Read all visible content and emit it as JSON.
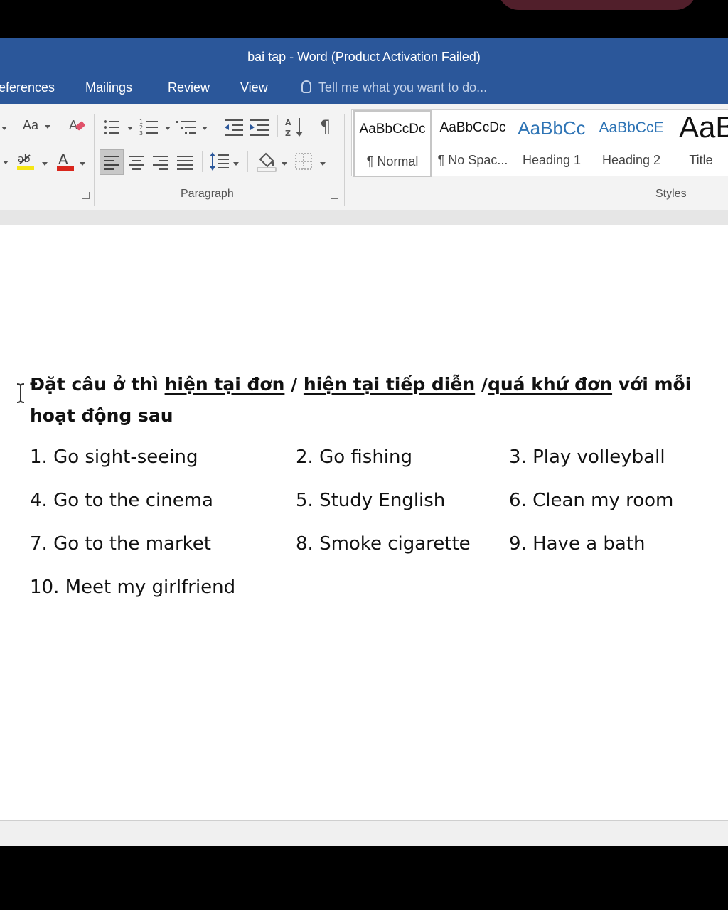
{
  "window": {
    "title": "bai tap - Word (Product Activation Failed)"
  },
  "tabs": [
    {
      "label": "eferences"
    },
    {
      "label": "Mailings"
    },
    {
      "label": "Review"
    },
    {
      "label": "View"
    }
  ],
  "tell_me": {
    "placeholder": "Tell me what you want to do..."
  },
  "ribbon": {
    "change_case_label": "Aa",
    "paragraph_label": "Paragraph",
    "styles_label": "Styles",
    "styles": [
      {
        "preview": "AaBbCcDc",
        "name": "¶ Normal"
      },
      {
        "preview": "AaBbCcDc",
        "name": "¶ No Spac..."
      },
      {
        "preview": "AaBbCc",
        "name": "Heading 1"
      },
      {
        "preview": "AaBbCcE",
        "name": "Heading 2"
      },
      {
        "preview": "AaB",
        "name": "Title"
      }
    ],
    "colors": {
      "highlight": "#f5e614",
      "font_color": "#d9261c",
      "accent": "#2b579a"
    }
  },
  "document": {
    "heading": {
      "p1": "Đặt câu ở thì ",
      "u1": "hiện tại đơn",
      "p2": " / ",
      "u2": "hiện tại tiếp diễn",
      "p3": " /",
      "u3": "quá khứ đơn",
      "p4": " với mỗi",
      "line2": "hoạt động sau"
    },
    "items": [
      "1. Go sight-seeing",
      "2. Go fishing",
      "3. Play volleyball",
      "4. Go to the cinema",
      "5. Study English",
      "6. Clean my room",
      "7. Go to the market",
      "8. Smoke cigarette",
      "9. Have a bath",
      "10. Meet my girlfriend"
    ]
  }
}
